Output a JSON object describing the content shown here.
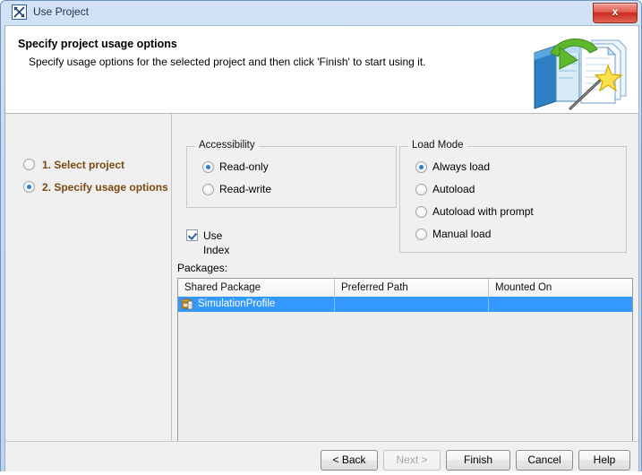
{
  "window": {
    "title": "Use Project",
    "title_icon": "magicdraw-project-icon",
    "close_label": "x"
  },
  "banner": {
    "title": "Specify project usage options",
    "subtitle": "Specify usage options for the selected project and then click 'Finish' to start using it.",
    "art_icon": "project-import-wizard-icon"
  },
  "nav": {
    "items": [
      {
        "label": "1. Select project",
        "selected": false
      },
      {
        "label": "2. Specify usage options",
        "selected": true
      }
    ]
  },
  "accessibility": {
    "legend": "Accessibility",
    "options": [
      {
        "label": "Read-only",
        "selected": true
      },
      {
        "label": "Read-write",
        "selected": false
      }
    ]
  },
  "use_index": {
    "label": "Use Index",
    "checked": true
  },
  "load_mode": {
    "legend": "Load Mode",
    "options": [
      {
        "label": "Always load",
        "selected": true
      },
      {
        "label": "Autoload",
        "selected": false
      },
      {
        "label": "Autoload with prompt",
        "selected": false
      },
      {
        "label": "Manual load",
        "selected": false
      }
    ]
  },
  "packages": {
    "label": "Packages:",
    "columns": [
      "Shared Package",
      "Preferred Path",
      "Mounted On"
    ],
    "rows": [
      {
        "icon": "shared-package-icon",
        "shared_package": "SimulationProfile",
        "preferred_path": "",
        "mounted_on": "",
        "selected": true
      }
    ]
  },
  "footer": {
    "buttons": [
      {
        "label": "< Back",
        "enabled": true
      },
      {
        "label": "Next >",
        "enabled": false
      },
      {
        "label": "Finish",
        "enabled": true
      },
      {
        "label": "Cancel",
        "enabled": true
      },
      {
        "label": "Help",
        "enabled": true
      }
    ]
  },
  "colors": {
    "selection_blue": "#3399ff",
    "nav_text": "#7a4a12",
    "radio_dot": "#2a7fd4",
    "close_red": "#c92a1c"
  }
}
